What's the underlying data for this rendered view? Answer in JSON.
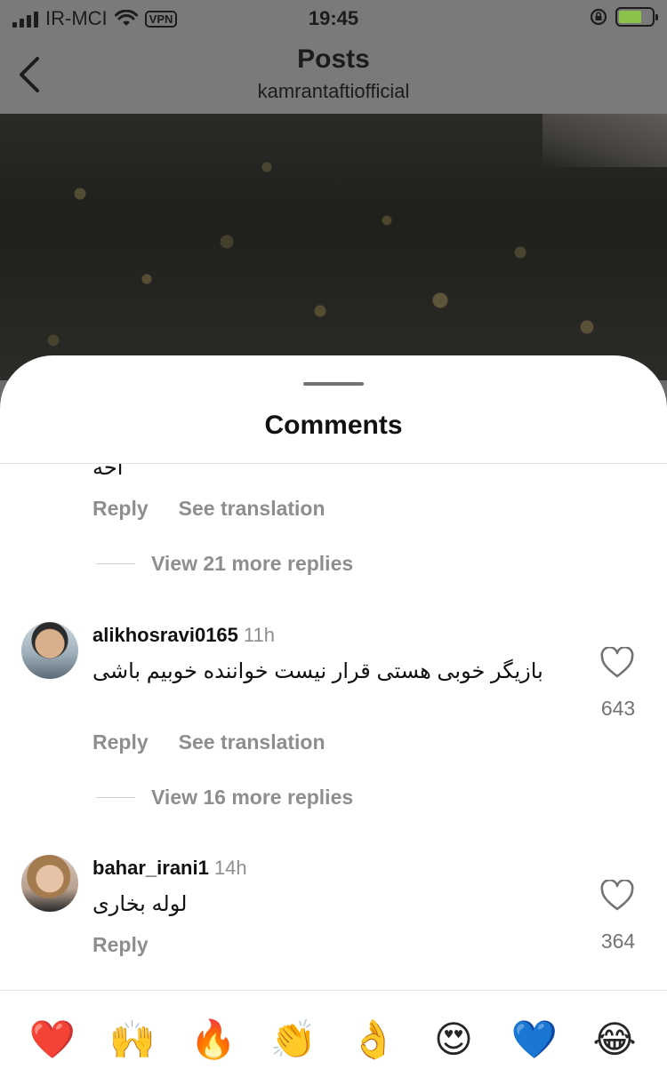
{
  "status_bar": {
    "carrier": "IR-MCI",
    "vpn": "VPN",
    "time": "19:45"
  },
  "header": {
    "title": "Posts",
    "username": "kamrantaftiofficial"
  },
  "sheet": {
    "title": "Comments"
  },
  "comments": [
    {
      "text_fragment": "احه",
      "actions": {
        "reply": "Reply",
        "translate": "See translation"
      },
      "view_replies": "View 21 more replies"
    },
    {
      "username": "alikhosravi0165",
      "time": "11h",
      "text": "بازیگر خوبی هستی قرار نیست خواننده خوبیم باشی",
      "likes": "643",
      "actions": {
        "reply": "Reply",
        "translate": "See translation"
      },
      "view_replies": "View 16 more replies"
    },
    {
      "username": "bahar_irani1",
      "time": "14h",
      "text": "لوله بخاری",
      "likes": "364",
      "actions": {
        "reply": "Reply"
      }
    }
  ],
  "emoji_bar": [
    {
      "name": "red-heart",
      "glyph": "❤️"
    },
    {
      "name": "raising-hands",
      "glyph": "🙌"
    },
    {
      "name": "fire",
      "glyph": "🔥"
    },
    {
      "name": "clapping-hands",
      "glyph": "👏"
    },
    {
      "name": "ok-hand",
      "glyph": "👌"
    },
    {
      "name": "heart-eyes",
      "glyph": "😍"
    },
    {
      "name": "blue-heart",
      "glyph": "💙"
    },
    {
      "name": "tears-of-joy",
      "glyph": "😂"
    }
  ],
  "colors": {
    "overlay": "#6b6b6b",
    "secondary_text": "#8e8e8e",
    "battery_charging": "#8bc34a"
  }
}
